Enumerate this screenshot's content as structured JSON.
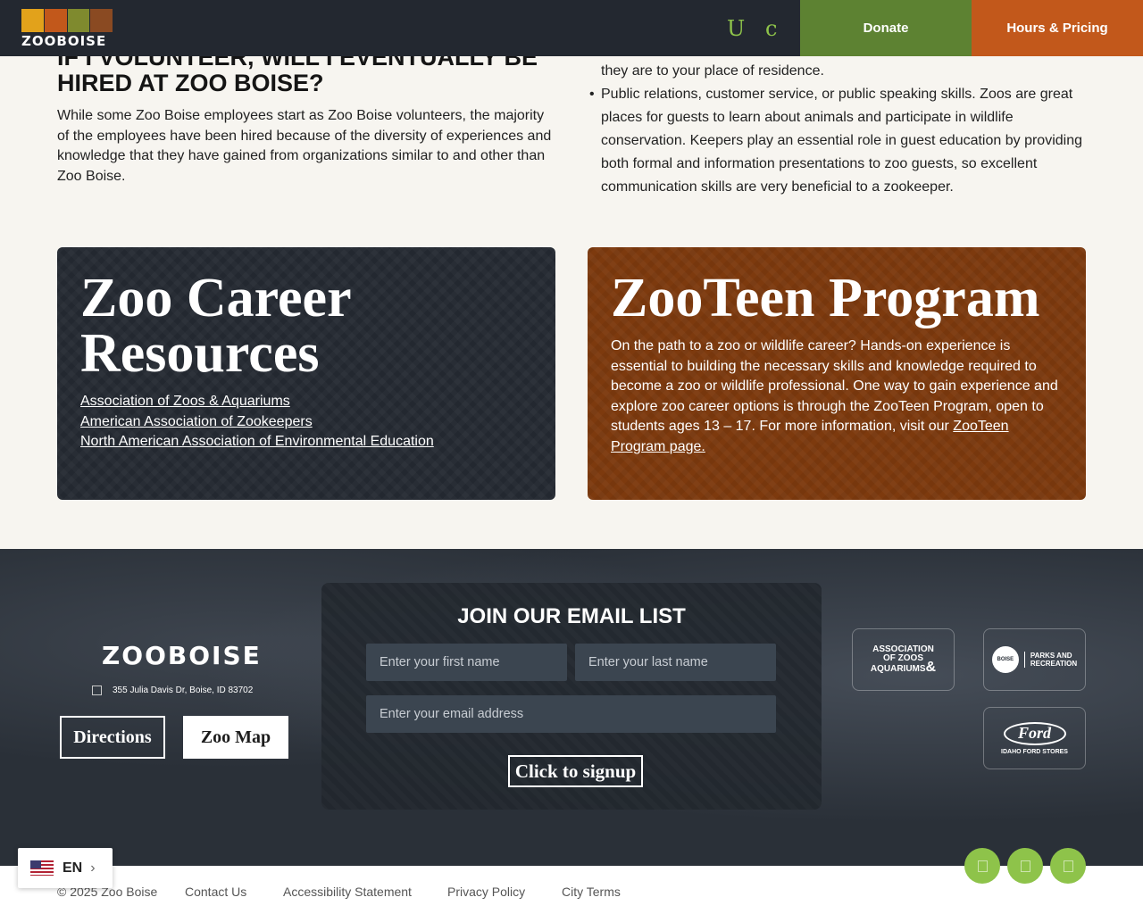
{
  "header": {
    "logo_text": "ZOOBOISE",
    "icon_glyphs": [
      "U",
      "c"
    ],
    "donate_label": "Donate",
    "hours_label": "Hours & Pricing",
    "brand_colors": {
      "dark": "#232830",
      "green": "#5d8232",
      "orange": "#c2581b",
      "icon_green": "#8ec34a"
    }
  },
  "faq": {
    "title": "IF I VOLUNTEER, WILL I EVENTUALLY BE HIRED AT ZOO BOISE?",
    "body": "While some Zoo Boise employees start as Zoo Boise volunteers, the majority of the employees have been hired because of the diversity of experiences and knowledge that they have gained from organizations similar to and other than Zoo Boise."
  },
  "skills": {
    "continuation": "they are to your place of residence.",
    "items": [
      "Public relations, customer service, or public speaking skills. Zoos are great places for guests to learn about animals and participate in wildlife conservation. Keepers play an essential role in guest education by providing both formal and information presentations to zoo guests, so excellent communication skills are very beneficial to a zookeeper."
    ]
  },
  "career_card": {
    "title": "Zoo Career Resources",
    "links": [
      "Association of Zoos & Aquariums",
      "American Association of Zookeepers",
      "North American Association of Environmental Education"
    ]
  },
  "zooteen_card": {
    "title": "ZooTeen Program",
    "text": "On the path to a zoo or wildlife career? Hands-on experience is essential to building the necessary skills and knowledge required to become a zoo or wildlife professional. One way to gain experience and explore zoo career options is through the ZooTeen Program, open to students ages 13 – 17. For more information, visit our ",
    "link_label": "ZooTeen Program page."
  },
  "footer": {
    "logo_text": "ZOOBOISE",
    "address": "355 Julia Davis Dr, Boise, ID 83702",
    "directions_label": "Directions",
    "map_label": "Zoo Map",
    "email": {
      "title": "JOIN OUR EMAIL LIST",
      "first_placeholder": "Enter your first name",
      "last_placeholder": "Enter your last name",
      "email_placeholder": "Enter your email address",
      "signup_label": "Click to signup"
    },
    "partners": {
      "aza_line1": "ASSOCIATION",
      "aza_line2": "OF ZOOS",
      "aza_line3": "AQUARIUMS",
      "aza_amp": "&",
      "parks_city": "BOISE",
      "parks_label_1": "PARKS AND",
      "parks_label_2": "RECREATION",
      "ford_logo": "Ford",
      "ford_label": "IDAHO FORD STORES"
    }
  },
  "bottom": {
    "copyright": "© 2025 Zoo Boise",
    "links": [
      "Contact Us",
      "Accessibility Statement",
      "Privacy Policy",
      "City Terms"
    ],
    "social_icons": [
      "facebook-icon",
      "instagram-icon",
      "youtube-icon"
    ]
  },
  "language": {
    "code": "EN",
    "chevron": "›"
  }
}
